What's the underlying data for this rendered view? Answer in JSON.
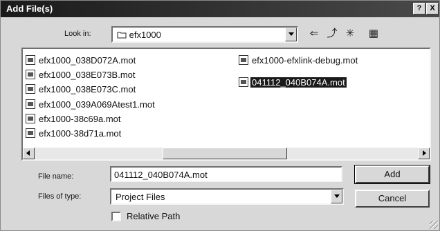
{
  "title": "Add File(s)",
  "titlebar_buttons": {
    "help": "?",
    "close": "X"
  },
  "look_in": {
    "label": "Look in:",
    "value": "efx1000",
    "icon": "folder-icon"
  },
  "toolbar": [
    {
      "name": "back-icon",
      "glyph": "⇐"
    },
    {
      "name": "up-folder-icon",
      "glyph": "⤴"
    },
    {
      "name": "new-folder-icon",
      "glyph": "✳"
    },
    {
      "name": "view-menu-icon",
      "glyph": "▦"
    }
  ],
  "files": [
    {
      "name": "efx1000_038D072A.mot",
      "selected": false
    },
    {
      "name": "efx1000_038E073B.mot",
      "selected": false
    },
    {
      "name": "efx1000_038E073C.mot",
      "selected": false
    },
    {
      "name": "efx1000_039A069Atest1.mot",
      "selected": false
    },
    {
      "name": "efx1000-38c69a.mot",
      "selected": false
    },
    {
      "name": "efx1000-38d71a.mot",
      "selected": false
    },
    {
      "name": "efx1000-efxlink-debug.mot",
      "selected": false
    },
    {
      "name": "041112_040B074A.mot",
      "selected": true
    }
  ],
  "file_name": {
    "label": "File name:",
    "value": "041112_040B074A.mot"
  },
  "files_of_type": {
    "label": "Files of type:",
    "value": "Project Files"
  },
  "relative_path": {
    "label": "Relative Path",
    "checked": false
  },
  "buttons": {
    "add": "Add",
    "cancel": "Cancel"
  }
}
